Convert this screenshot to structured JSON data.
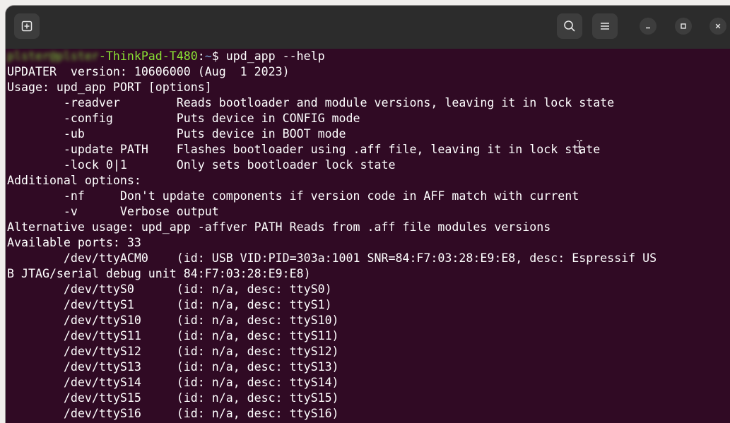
{
  "titlebar": {
    "new_tab_icon": "new-tab-icon",
    "search_icon": "search-icon",
    "menu_icon": "hamburger-menu-icon",
    "minimize_icon": "minimize-icon",
    "maximize_icon": "maximize-icon",
    "close_icon": "close-icon"
  },
  "colors": {
    "terminal_bg": "#300a24",
    "titlebar_bg": "#2c2c2c",
    "prompt_user_host": "#8ae234",
    "prompt_path": "#729fcf",
    "text": "#ffffff"
  },
  "prompt": {
    "user": "plster@plster",
    "host": "-ThinkPad-T480",
    "sep": ":",
    "path": "~",
    "symbol": "$ ",
    "command": "upd_app --help"
  },
  "output": [
    "UPDATER  version: 10606000 (Aug  1 2023)",
    "Usage: upd_app PORT [options]",
    "        -readver        Reads bootloader and module versions, leaving it in lock state",
    "        -config         Puts device in CONFIG mode",
    "        -ub             Puts device in BOOT mode",
    "        -update PATH    Flashes bootloader using .aff file, leaving it in lock state",
    "        -lock 0|1       Only sets bootloader lock state",
    "Additional options:",
    "        -nf     Don't update components if version code in AFF match with current",
    "        -v      Verbose output",
    "Alternative usage: upd_app -affver PATH Reads from .aff file modules versions",
    "Available ports: 33",
    "        /dev/ttyACM0    (id: USB VID:PID=303a:1001 SNR=84:F7:03:28:E9:E8, desc: Espressif US",
    "B JTAG/serial debug unit 84:F7:03:28:E9:E8)",
    "        /dev/ttyS0      (id: n/a, desc: ttyS0)",
    "        /dev/ttyS1      (id: n/a, desc: ttyS1)",
    "        /dev/ttyS10     (id: n/a, desc: ttyS10)",
    "        /dev/ttyS11     (id: n/a, desc: ttyS11)",
    "        /dev/ttyS12     (id: n/a, desc: ttyS12)",
    "        /dev/ttyS13     (id: n/a, desc: ttyS13)",
    "        /dev/ttyS14     (id: n/a, desc: ttyS14)",
    "        /dev/ttyS15     (id: n/a, desc: ttyS15)",
    "        /dev/ttyS16     (id: n/a, desc: ttyS16)"
  ]
}
